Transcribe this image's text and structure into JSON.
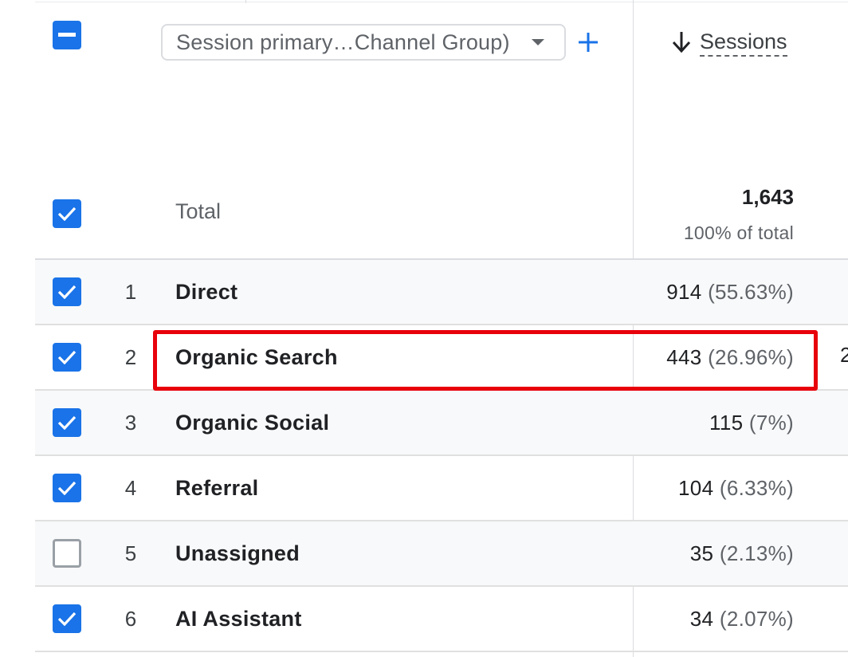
{
  "dimension_selector": {
    "label": "Session primary…Channel Group)"
  },
  "metric_header": {
    "label": "Sessions",
    "sort": "descending"
  },
  "totals": {
    "label": "Total",
    "value": "1,643",
    "percent": "100% of total"
  },
  "rows": [
    {
      "rank": "1",
      "name": "Direct",
      "value": "914",
      "percent": "(55.63%)",
      "checked": true
    },
    {
      "rank": "2",
      "name": "Organic Search",
      "value": "443",
      "percent": "(26.96%)",
      "checked": true
    },
    {
      "rank": "3",
      "name": "Organic Social",
      "value": "115",
      "percent": "(7%)",
      "checked": true
    },
    {
      "rank": "4",
      "name": "Referral",
      "value": "104",
      "percent": "(6.33%)",
      "checked": true
    },
    {
      "rank": "5",
      "name": "Unassigned",
      "value": "35",
      "percent": "(2.13%)",
      "checked": false
    },
    {
      "rank": "6",
      "name": "AI Assistant",
      "value": "34",
      "percent": "(2.07%)",
      "checked": true
    }
  ],
  "clipped_next_column": {
    "row_2_fragment": "2"
  },
  "colors": {
    "accent": "#1a73e8",
    "highlight": "#e8000b"
  }
}
